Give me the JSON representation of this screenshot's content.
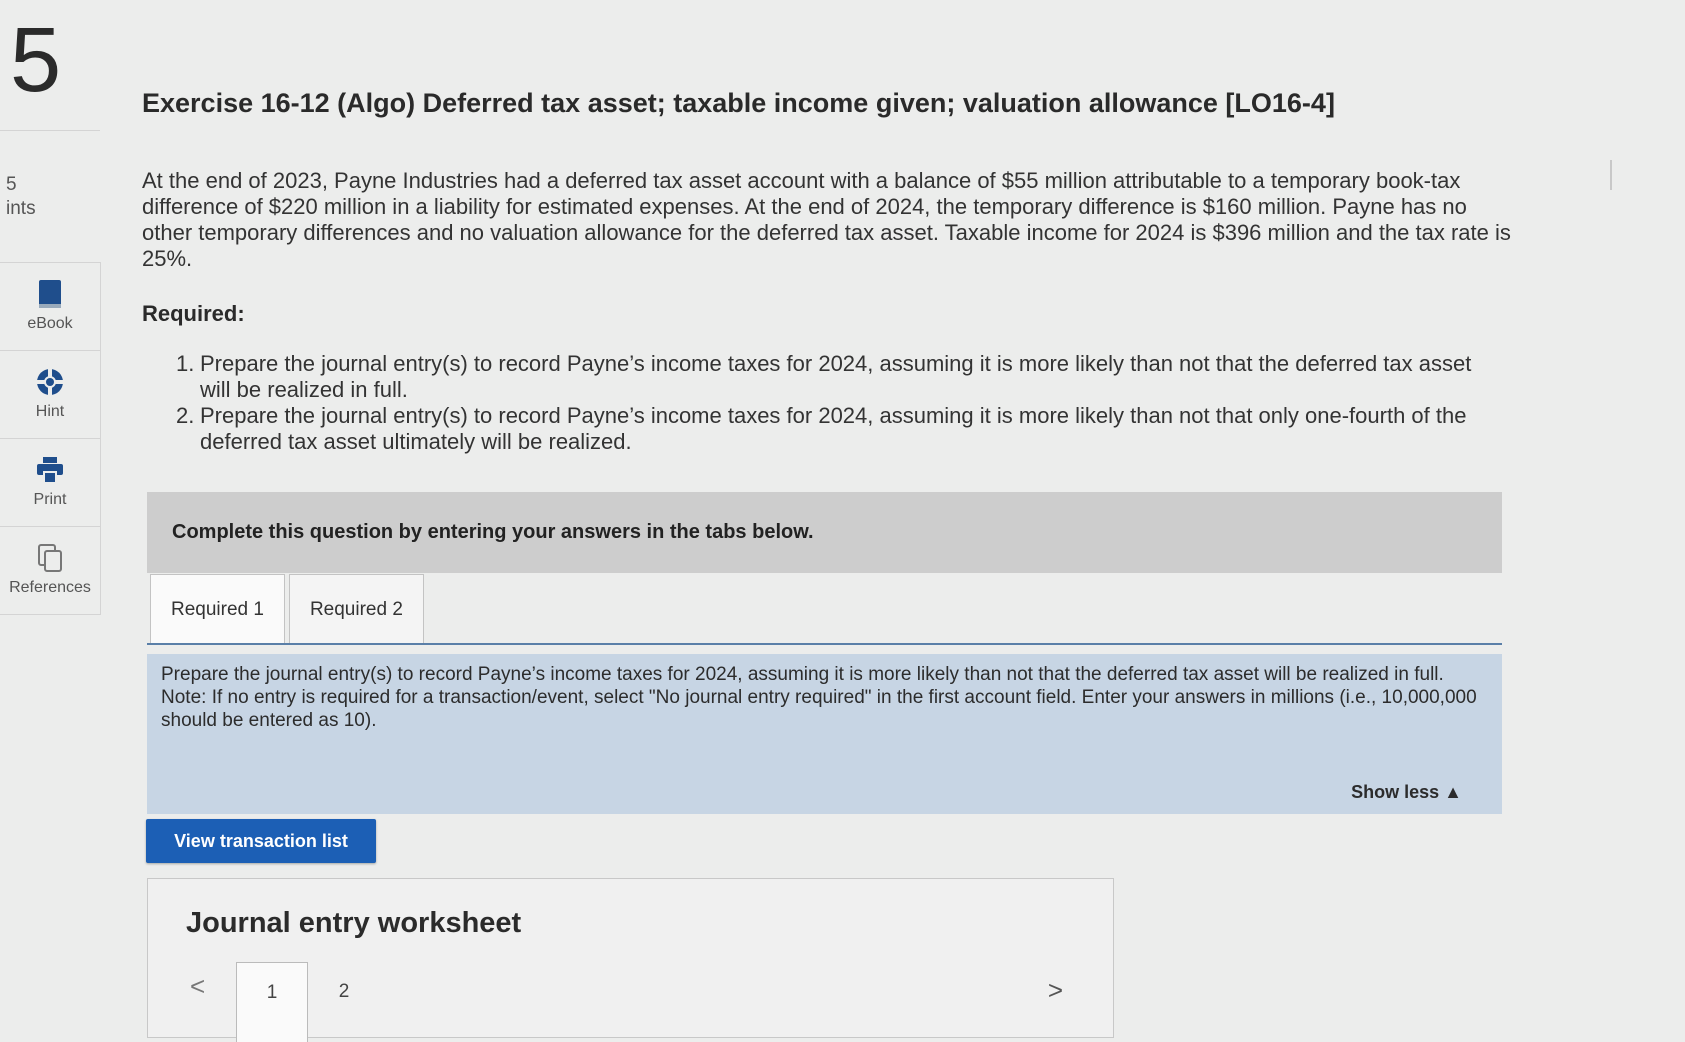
{
  "question": {
    "number": "5",
    "points_value": "5",
    "points_label": "ints"
  },
  "tools": [
    {
      "label": "eBook",
      "icon": "book-icon"
    },
    {
      "label": "Hint",
      "icon": "lifebuoy-icon"
    },
    {
      "label": "Print",
      "icon": "printer-icon"
    },
    {
      "label": "References",
      "icon": "copy-icon"
    }
  ],
  "title": "Exercise 16-12 (Algo) Deferred tax asset; taxable income given; valuation allowance [LO16-4]",
  "intro": "At the end of 2023, Payne Industries had a deferred tax asset account with a balance of $55 million attributable to a temporary book-tax difference of $220 million in a liability for estimated expenses. At the end of 2024, the temporary difference is $160 million. Payne has no other temporary differences and no valuation allowance for the deferred tax asset. Taxable income for 2024 is $396 million and the tax rate is 25%.",
  "required_heading": "Required:",
  "requirements": [
    {
      "num": "1.",
      "text": "Prepare the journal entry(s) to record Payne’s income taxes for 2024, assuming it is more likely than not that the deferred tax asset will be realized in full."
    },
    {
      "num": "2.",
      "text": "Prepare the journal entry(s) to record Payne’s income taxes for 2024, assuming it is more likely than not that only one-fourth of the deferred tax asset ultimately will be realized."
    }
  ],
  "instruction_bar": "Complete this question by entering your answers in the tabs below.",
  "tabs": [
    {
      "label": "Required 1",
      "active": true
    },
    {
      "label": "Required 2",
      "active": false
    }
  ],
  "prompt": {
    "text": "Prepare the journal entry(s) to record Payne’s income taxes for 2024, assuming it is more likely than not that the deferred tax asset will be realized in full.",
    "note": "Note: If no entry is required for a transaction/event, select \"No journal entry required\" in the first account field. Enter your answers in millions (i.e., 10,000,000 should be entered as 10).",
    "show_less": "Show less ▲"
  },
  "view_button": "View transaction list",
  "worksheet": {
    "title": "Journal entry worksheet",
    "prev": "<",
    "next": ">",
    "pages": [
      "1",
      "2"
    ],
    "active_page": "1"
  },
  "colors": {
    "accent": "#1c5fb5",
    "prompt_bg": "#c7d5e4",
    "instruction_bg": "#cdcdcd"
  }
}
